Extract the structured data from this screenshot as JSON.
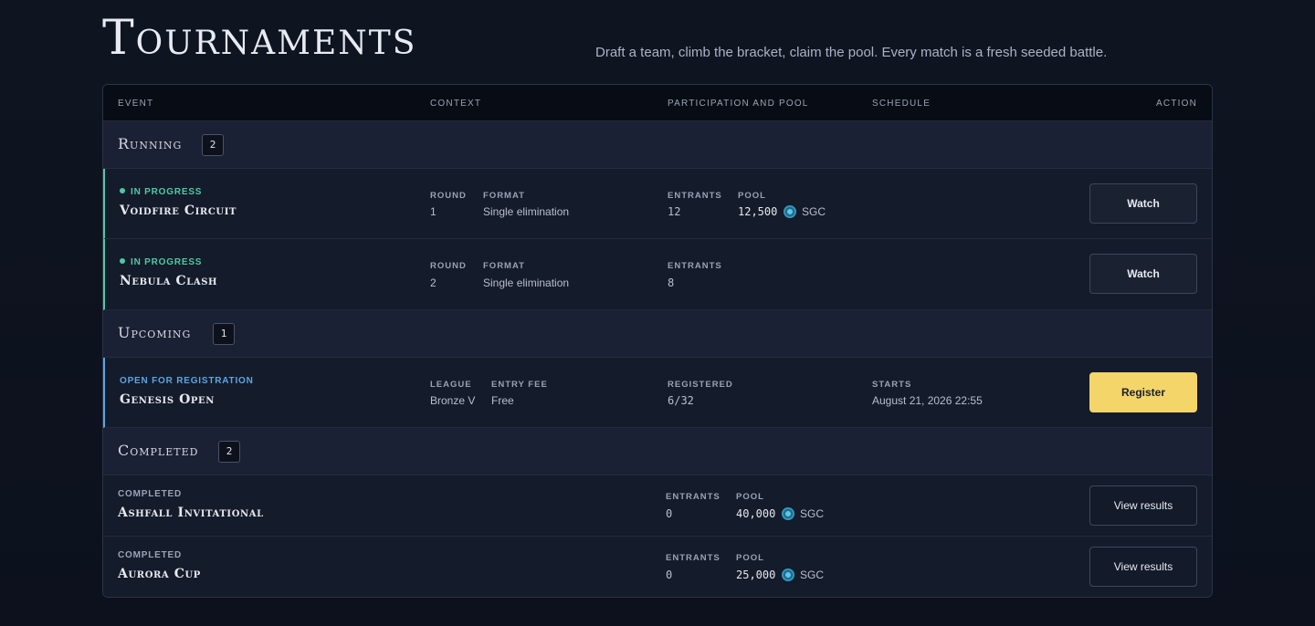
{
  "page": {
    "title": "Tournaments",
    "tagline": "Draft a team, climb the bracket, claim the pool. Every match is a fresh seeded battle."
  },
  "table": {
    "headers": {
      "event": "EVENT",
      "context": "CONTEXT",
      "participation": "PARTICIPATION AND POOL",
      "schedule": "SCHEDULE",
      "action": "ACTION"
    }
  },
  "currency": "SGC",
  "sections": {
    "running": {
      "title": "Running",
      "count": "2",
      "rows": [
        {
          "status": "IN PROGRESS",
          "name": "Voidfire Circuit",
          "ctx1_label": "ROUND",
          "ctx1_value": "1",
          "ctx2_label": "FORMAT",
          "ctx2_value": "Single elimination",
          "p1_label": "ENTRANTS",
          "p1_value": "12",
          "p2_label": "POOL",
          "p2_value": "12,500",
          "action": "Watch"
        },
        {
          "status": "IN PROGRESS",
          "name": "Nebula Clash",
          "ctx1_label": "ROUND",
          "ctx1_value": "2",
          "ctx2_label": "FORMAT",
          "ctx2_value": "Single elimination",
          "p1_label": "ENTRANTS",
          "p1_value": "8",
          "action": "Watch"
        }
      ]
    },
    "upcoming": {
      "title": "Upcoming",
      "count": "1",
      "rows": [
        {
          "status": "OPEN FOR REGISTRATION",
          "name": "Genesis Open",
          "ctx1_label": "LEAGUE",
          "ctx1_value": "Bronze V",
          "ctx2_label": "ENTRY FEE",
          "ctx2_value": "Free",
          "p1_label": "REGISTERED",
          "p1_value": "6/32",
          "sched_label": "STARTS",
          "sched_value": "August 21, 2026 22:55",
          "action": "Register"
        }
      ]
    },
    "completed": {
      "title": "Completed",
      "count": "2",
      "rows": [
        {
          "status": "COMPLETED",
          "name": "Ashfall Invitational",
          "p1_label": "ENTRANTS",
          "p1_value": "0",
          "p2_label": "POOL",
          "p2_value": "40,000",
          "action": "View results"
        },
        {
          "status": "COMPLETED",
          "name": "Aurora Cup",
          "p1_label": "ENTRANTS",
          "p1_value": "0",
          "p2_label": "POOL",
          "p2_value": "25,000",
          "action": "View results"
        }
      ]
    }
  },
  "colors": {
    "running_accent": "#4ec9a5",
    "upcoming_accent": "#5aa6e6",
    "primary_button": "#f4d56a"
  }
}
